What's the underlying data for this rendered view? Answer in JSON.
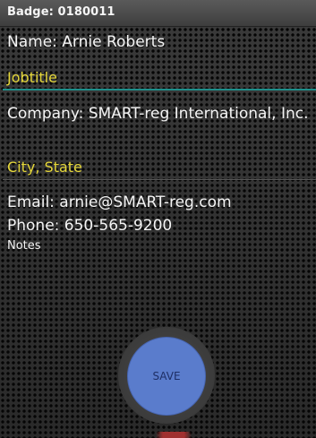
{
  "titlebar": {
    "title": "Badge: 0180011"
  },
  "fields": {
    "name": "Name: Arnie Roberts",
    "jobtitle": "Jobtitle",
    "company": "Company: SMART-reg International, Inc.",
    "citystate": "City, State",
    "email": "Email: arnie@SMART-reg.com",
    "phone": "Phone: 650-565-9200",
    "notes": "Notes"
  },
  "actions": {
    "save_label": "SAVE"
  },
  "colors": {
    "accent_yellow": "#e6d83a",
    "teal_rule": "#1f8f8a",
    "save_button": "#5a7ccc"
  }
}
